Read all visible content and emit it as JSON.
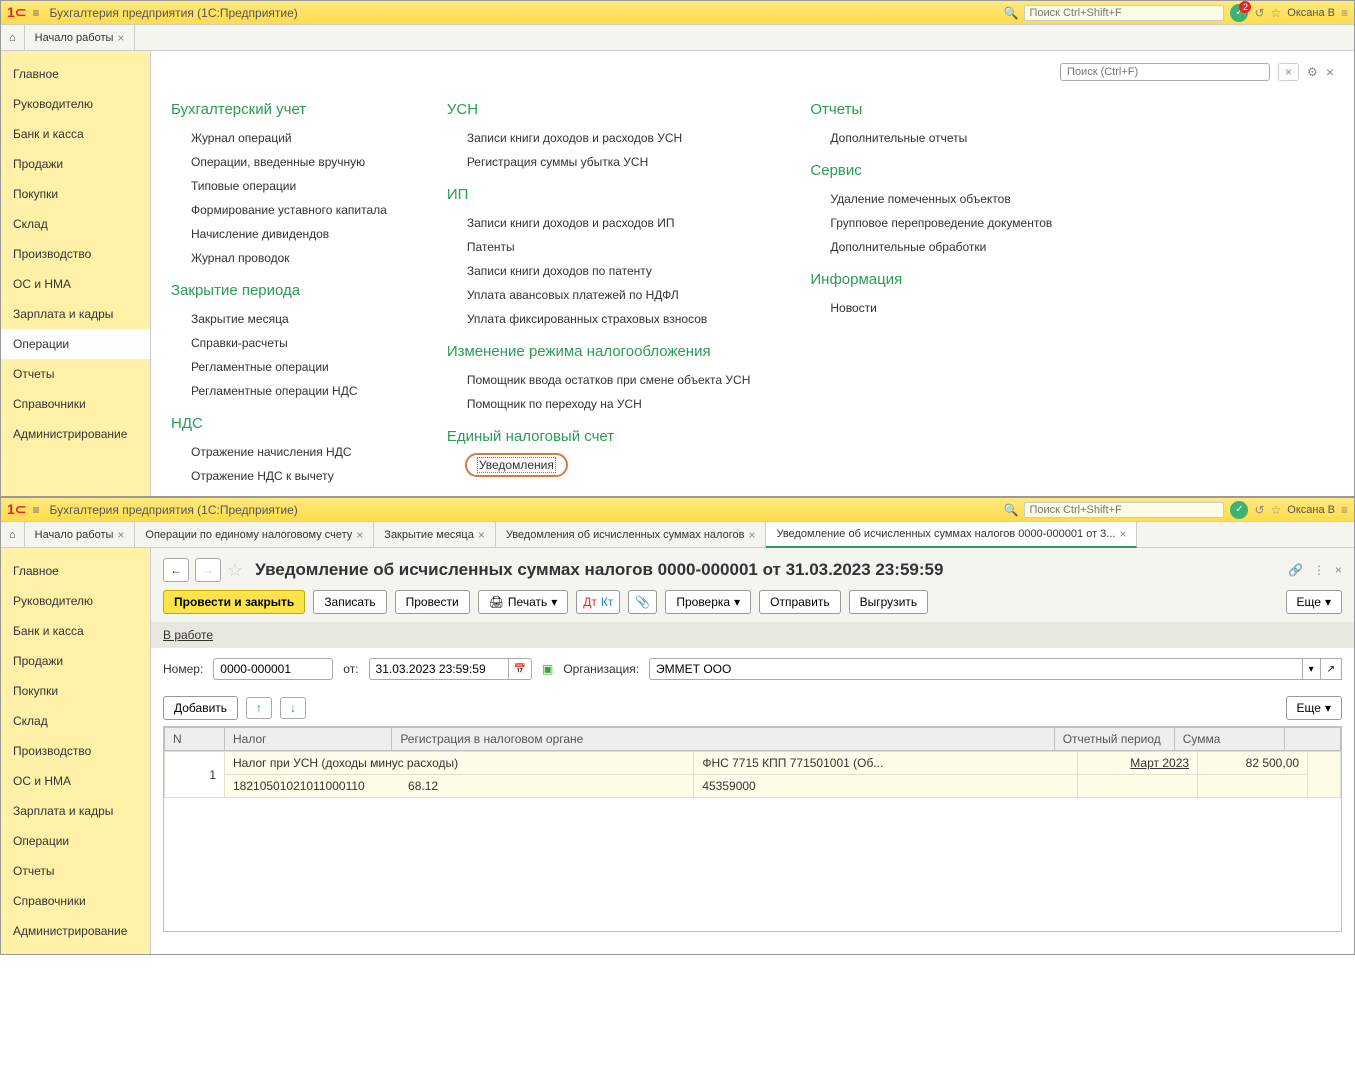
{
  "top": {
    "app_title": "Бухгалтерия предприятия  (1С:Предприятие)",
    "search_placeholder": "Поиск Ctrl+Shift+F",
    "badge_count": "2",
    "username": "Оксана В",
    "tabs": {
      "home": "⌂",
      "start": "Начало работы"
    },
    "sidebar": [
      "Главное",
      "Руководителю",
      "Банк и касса",
      "Продажи",
      "Покупки",
      "Склад",
      "Производство",
      "ОС и НМА",
      "Зарплата и кадры",
      "Операции",
      "Отчеты",
      "Справочники",
      "Администрирование"
    ],
    "ops_search_placeholder": "Поиск (Ctrl+F)",
    "sections": {
      "buh": {
        "title": "Бухгалтерский учет",
        "items": [
          "Журнал операций",
          "Операции, введенные вручную",
          "Типовые операции",
          "Формирование уставного капитала",
          "Начисление дивидендов",
          "Журнал проводок"
        ]
      },
      "close": {
        "title": "Закрытие периода",
        "items": [
          "Закрытие месяца",
          "Справки-расчеты",
          "Регламентные операции",
          "Регламентные операции НДС"
        ]
      },
      "nds": {
        "title": "НДС",
        "items": [
          "Отражение начисления НДС",
          "Отражение НДС к вычету"
        ]
      },
      "usn": {
        "title": "УСН",
        "items": [
          "Записи книги доходов и расходов УСН",
          "Регистрация суммы убытка УСН"
        ]
      },
      "ip": {
        "title": "ИП",
        "items": [
          "Записи книги доходов и расходов ИП",
          "Патенты",
          "Записи книги доходов по патенту",
          "Уплата авансовых платежей по НДФЛ",
          "Уплата фиксированных страховых взносов"
        ]
      },
      "mode": {
        "title": "Изменение режима налогообложения",
        "items": [
          "Помощник ввода остатков при смене объекта УСН",
          "Помощник по переходу на УСН"
        ]
      },
      "ens": {
        "title": "Единый налоговый счет",
        "items": [
          "Уведомления"
        ]
      },
      "reports": {
        "title": "Отчеты",
        "items": [
          "Дополнительные отчеты"
        ]
      },
      "service": {
        "title": "Сервис",
        "items": [
          "Удаление помеченных объектов",
          "Групповое перепроведение документов",
          "Дополнительные обработки"
        ]
      },
      "info": {
        "title": "Информация",
        "items": [
          "Новости"
        ]
      }
    }
  },
  "bottom": {
    "app_title": "Бухгалтерия предприятия  (1С:Предприятие)",
    "search_placeholder": "Поиск Ctrl+Shift+F",
    "username": "Оксана В",
    "tabs": [
      "Начало работы",
      "Операции по единому налоговому счету",
      "Закрытие месяца",
      "Уведомления об исчисленных суммах налогов",
      "Уведомление об исчисленных суммах налогов 0000-000001 от 3..."
    ],
    "sidebar": [
      "Главное",
      "Руководителю",
      "Банк и касса",
      "Продажи",
      "Покупки",
      "Склад",
      "Производство",
      "ОС и НМА",
      "Зарплата и кадры",
      "Операции",
      "Отчеты",
      "Справочники",
      "Администрирование"
    ],
    "doc_title": "Уведомление об исчисленных суммах налогов 0000-000001 от 31.03.2023 23:59:59",
    "toolbar": {
      "post_close": "Провести и закрыть",
      "save": "Записать",
      "post": "Провести",
      "print": "Печать",
      "check": "Проверка",
      "send": "Отправить",
      "export": "Выгрузить",
      "more": "Еще"
    },
    "status": "В работе",
    "form": {
      "number_label": "Номер:",
      "number": "0000-000001",
      "from_label": "от:",
      "date": "31.03.2023 23:59:59",
      "org_label": "Организация:",
      "org": "ЭММЕТ ООО"
    },
    "table_toolbar": {
      "add": "Добавить",
      "more": "Еще"
    },
    "grid": {
      "headers": [
        "N",
        "Налог",
        "Регистрация в налоговом органе",
        "Отчетный период",
        "Сумма"
      ],
      "row1": {
        "n": "1",
        "tax": "Налог при УСН (доходы минус расходы)",
        "reg": "ФНС 7715 КПП 771501001 (Об...",
        "period": "Март 2023",
        "sum": "82 500,00"
      },
      "row2": {
        "tax_code": "18210501021011000110",
        "kbk": "68.12",
        "oktmo": "45359000"
      }
    }
  }
}
